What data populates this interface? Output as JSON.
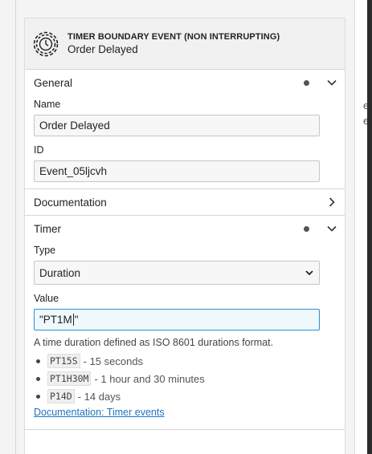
{
  "header": {
    "element_type": "TIMER BOUNDARY EVENT (NON INTERRUPTING)",
    "element_name": "Order Delayed",
    "icon": "timer-event-icon"
  },
  "groups": {
    "general": {
      "title": "General",
      "has_dot": true,
      "expanded": true,
      "name_label": "Name",
      "name_value": "Order Delayed",
      "id_label": "ID",
      "id_value": "Event_05ljcvh"
    },
    "documentation": {
      "title": "Documentation",
      "expanded": false
    },
    "timer": {
      "title": "Timer",
      "has_dot": true,
      "expanded": true,
      "type_label": "Type",
      "type_value": "Duration",
      "value_label": "Value",
      "value_before_caret": "\"PT1M",
      "value_after_caret": "\"",
      "description": "A time duration defined as ISO 8601 durations format.",
      "examples": [
        {
          "code": "PT15S",
          "text": "- 15 seconds"
        },
        {
          "code": "PT1H30M",
          "text": "- 1 hour and 30 minutes"
        },
        {
          "code": "P14D",
          "text": "- 14 days"
        }
      ],
      "doc_link": "Documentation: Timer events"
    }
  },
  "canvas": {
    "line1": "e",
    "line2": "e"
  },
  "colors": {
    "accent_link": "#1f74c1",
    "focus_border": "#2f8fd0",
    "focus_bg": "#eef8fd",
    "header_bg": "#f1f1f1"
  }
}
